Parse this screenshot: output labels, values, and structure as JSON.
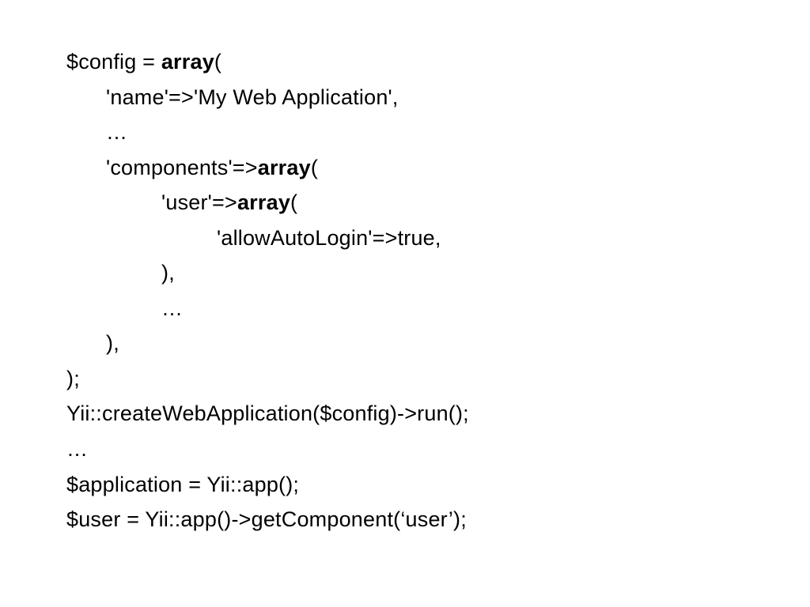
{
  "code": {
    "l1_a": "$config = ",
    "l1_b": "array",
    "l1_c": "(",
    "l2": "'name'=>'My Web Application',",
    "l3": "…",
    "l4_a": "'components'=>",
    "l4_b": "array",
    "l4_c": "(",
    "l5_a": "'user'=>",
    "l5_b": "array",
    "l5_c": "(",
    "l6": "'allowAutoLogin'=>true,",
    "l7": "),",
    "l8": "…",
    "l9": "),",
    "l10": ");",
    "l11": "Yii::createWebApplication($config)->run();",
    "l12": "…",
    "l13": "$application = Yii::app();",
    "l14": "$user = Yii::app()->getComponent(‘user’);"
  }
}
